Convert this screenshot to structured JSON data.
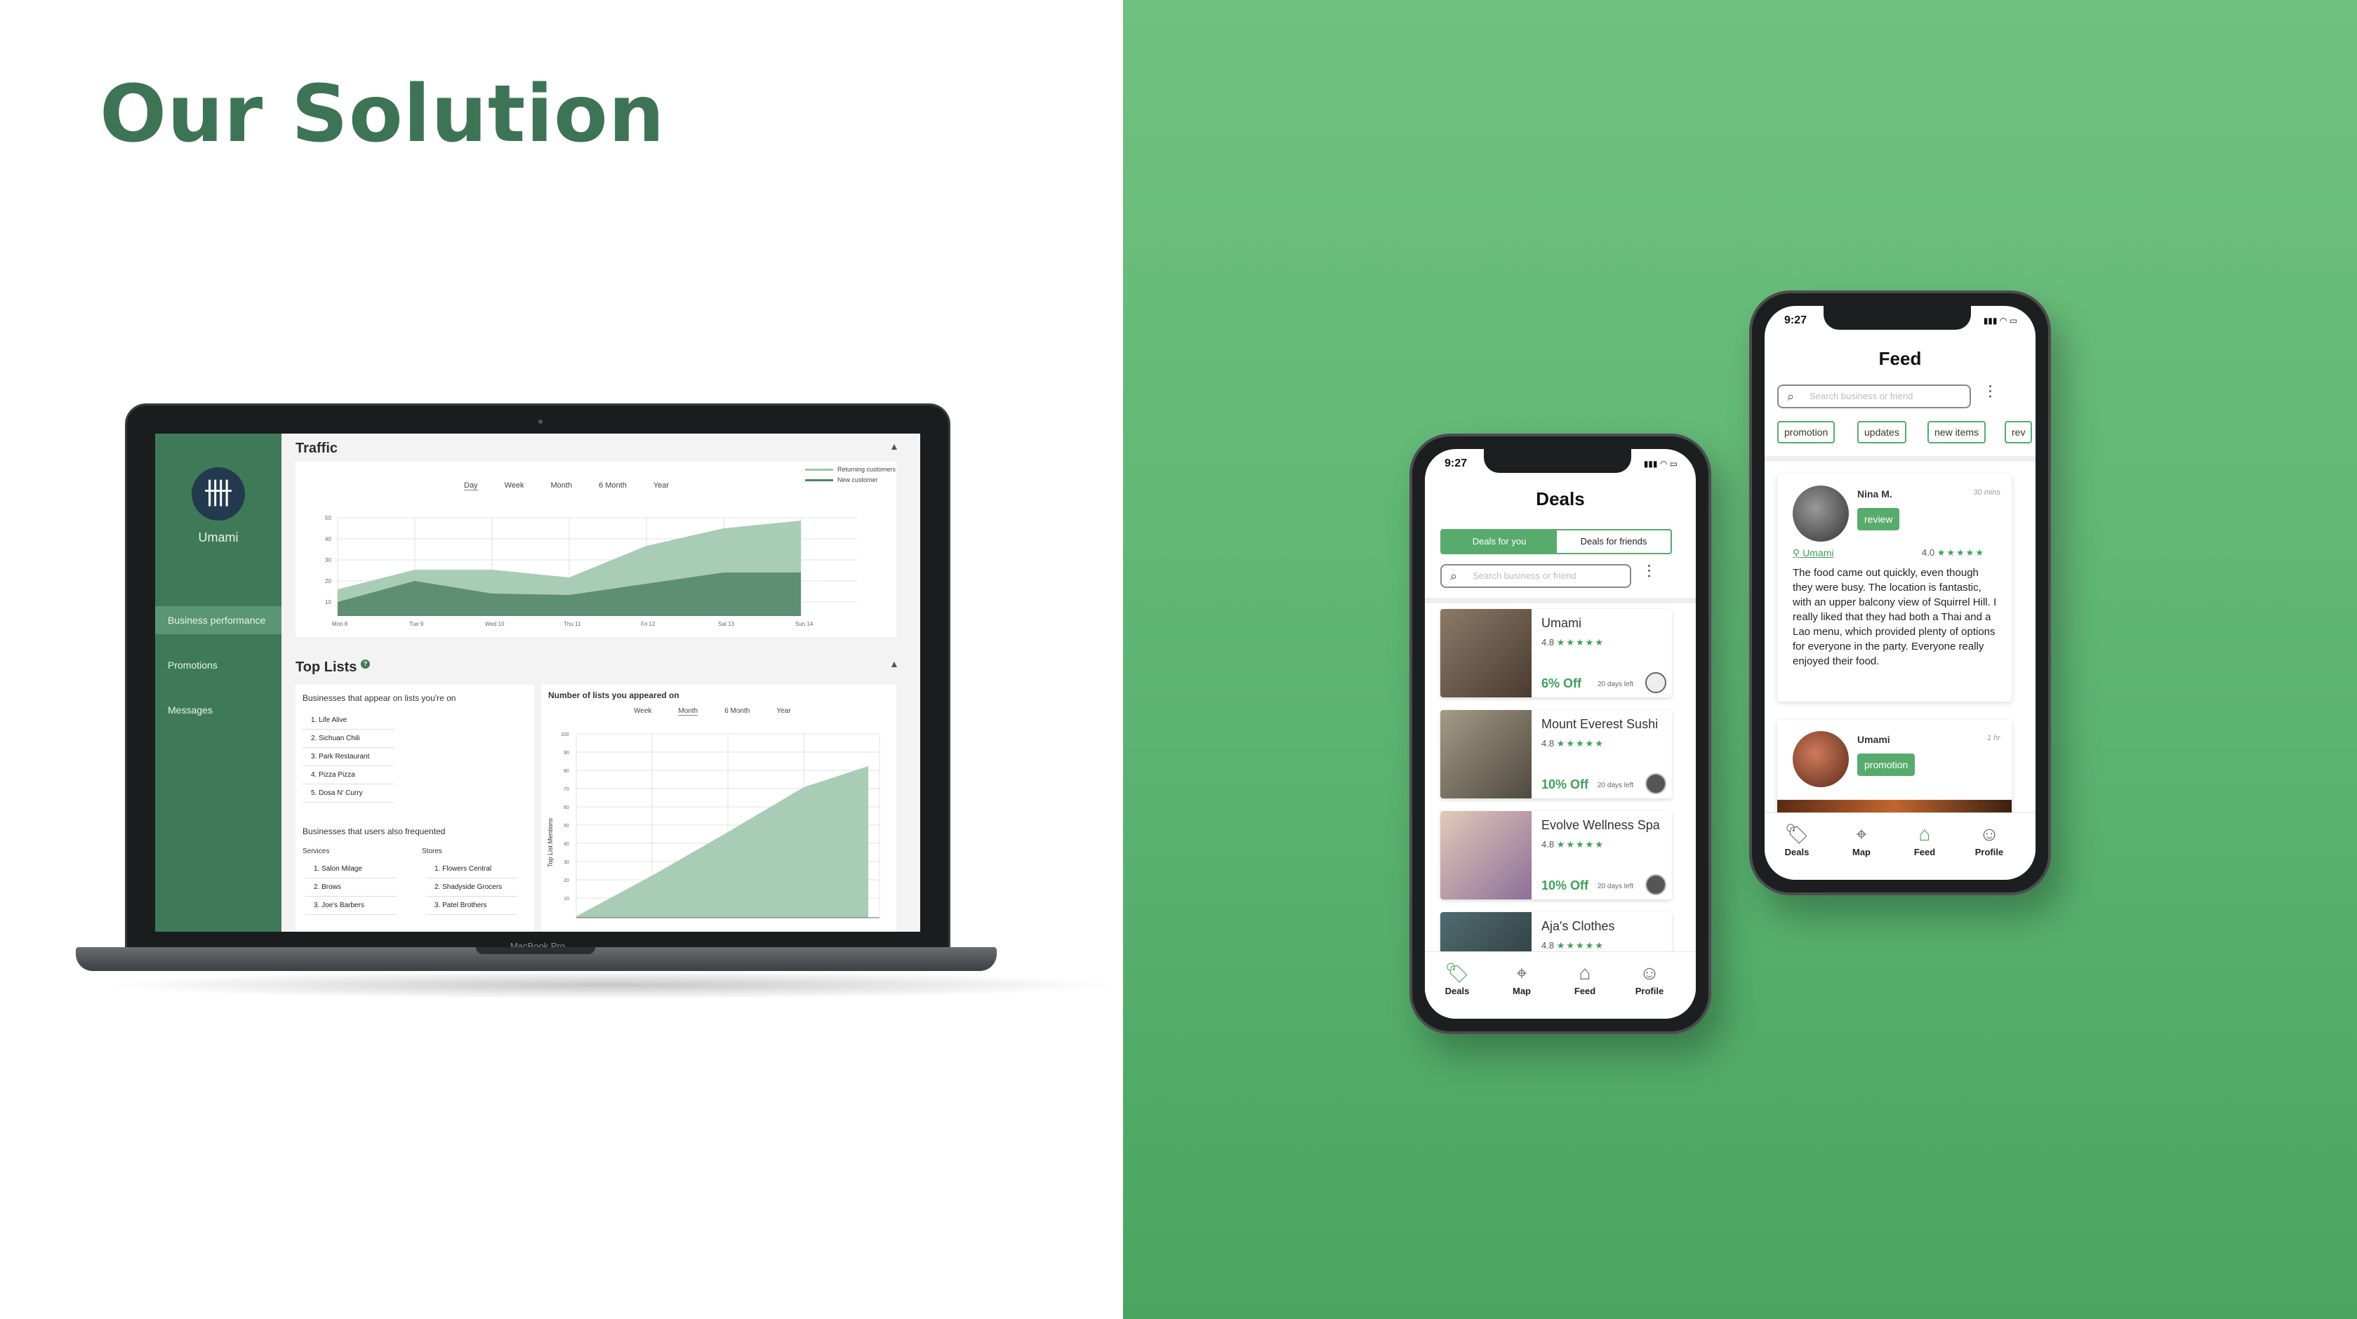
{
  "slide": {
    "title": "Our Solution"
  },
  "dashboard": {
    "brand": "Umami",
    "nav": [
      "Business performance",
      "Promotions",
      "Messages"
    ],
    "traffic": {
      "title": "Traffic",
      "tabs": [
        "Day",
        "Week",
        "Month",
        "6 Month",
        "Year"
      ],
      "selected_tab": "Day",
      "legend": [
        {
          "label": "Returning customers",
          "color": "#9dc5ac"
        },
        {
          "label": "New customer",
          "color": "#4e8465"
        }
      ],
      "y_ticks": [
        "50",
        "40",
        "30",
        "20",
        "10"
      ],
      "x_ticks": [
        "Mon 8",
        "Tue 9",
        "Wed 10",
        "Thu 11",
        "Fri 12",
        "Sat 13",
        "Sun 14"
      ]
    },
    "toplists": {
      "title": "Top Lists",
      "help": "?",
      "left_heading": "Businesses that appear on lists you're on",
      "items": [
        "1. Life Alive",
        "2. Sichuan Chili",
        "3. Park Restaurant",
        "4. Pizza Pizza",
        "5. Dosa N' Curry"
      ],
      "freq_heading": "Businesses that users also frequented",
      "services_label": "Services",
      "stores_label": "Stores",
      "services": [
        "1. Salon Milage",
        "2. Brows",
        "3. Joe's Barbers"
      ],
      "stores": [
        "1. Flowers Central",
        "2. Shadyside Grocers",
        "3. Patel Brothers"
      ],
      "chart_title": "Number of lists you appeared on",
      "chart_tabs": [
        "Week",
        "Month",
        "6 Month",
        "Year"
      ],
      "chart_selected": "Month",
      "y_axis_label": "Top List Mentions",
      "y_ticks": [
        "100",
        "90",
        "80",
        "70",
        "60",
        "50",
        "40",
        "30",
        "20",
        "10"
      ]
    },
    "device_label": "MacBook Pro"
  },
  "deals_phone": {
    "time": "9:27",
    "title": "Deals",
    "seg": [
      "Deals for you",
      "Deals for friends"
    ],
    "search_placeholder": "Search business or friend",
    "deals": [
      {
        "name": "Umami",
        "rating": "4.8",
        "stars": "★★★★★",
        "off": "6% Off",
        "left": "20 days left",
        "img": "#6b5b4e"
      },
      {
        "name": "Mount Everest Sushi",
        "rating": "4.8",
        "stars": "★★★★★",
        "off": "10% Off",
        "left": "20 days left",
        "img": "#7a7160"
      },
      {
        "name": "Evolve Wellness Spa",
        "rating": "4.8",
        "stars": "★★★★★",
        "off": "10% Off",
        "left": "20 days left",
        "img": "#c8a99e"
      },
      {
        "name": "Aja's Clothes",
        "rating": "4.8",
        "stars": "★★★★★",
        "off": "",
        "left": "",
        "img": "#3f5357"
      }
    ],
    "tabs": [
      "Deals",
      "Map",
      "Feed",
      "Profile"
    ]
  },
  "feed_phone": {
    "time": "9:27",
    "title": "Feed",
    "search_placeholder": "Search business or friend",
    "chips": [
      "promotion",
      "updates",
      "new items",
      "rev"
    ],
    "post1": {
      "user": "Nina M.",
      "time": "30 mins",
      "tag": "review",
      "place": "Umami",
      "rating": "4.0",
      "stars": "★★★★★",
      "text": "The food came out quickly, even though they were busy. The location is fantastic, with an upper balcony view of Squirrel Hill. I really liked that they had both a Thai and a Lao menu, which provided plenty of options for everyone in the party. Everyone really enjoyed their food."
    },
    "post2": {
      "user": "Umami",
      "time": "1 hr",
      "tag": "promotion"
    },
    "tabs": [
      "Deals",
      "Map",
      "Feed",
      "Profile"
    ]
  }
}
